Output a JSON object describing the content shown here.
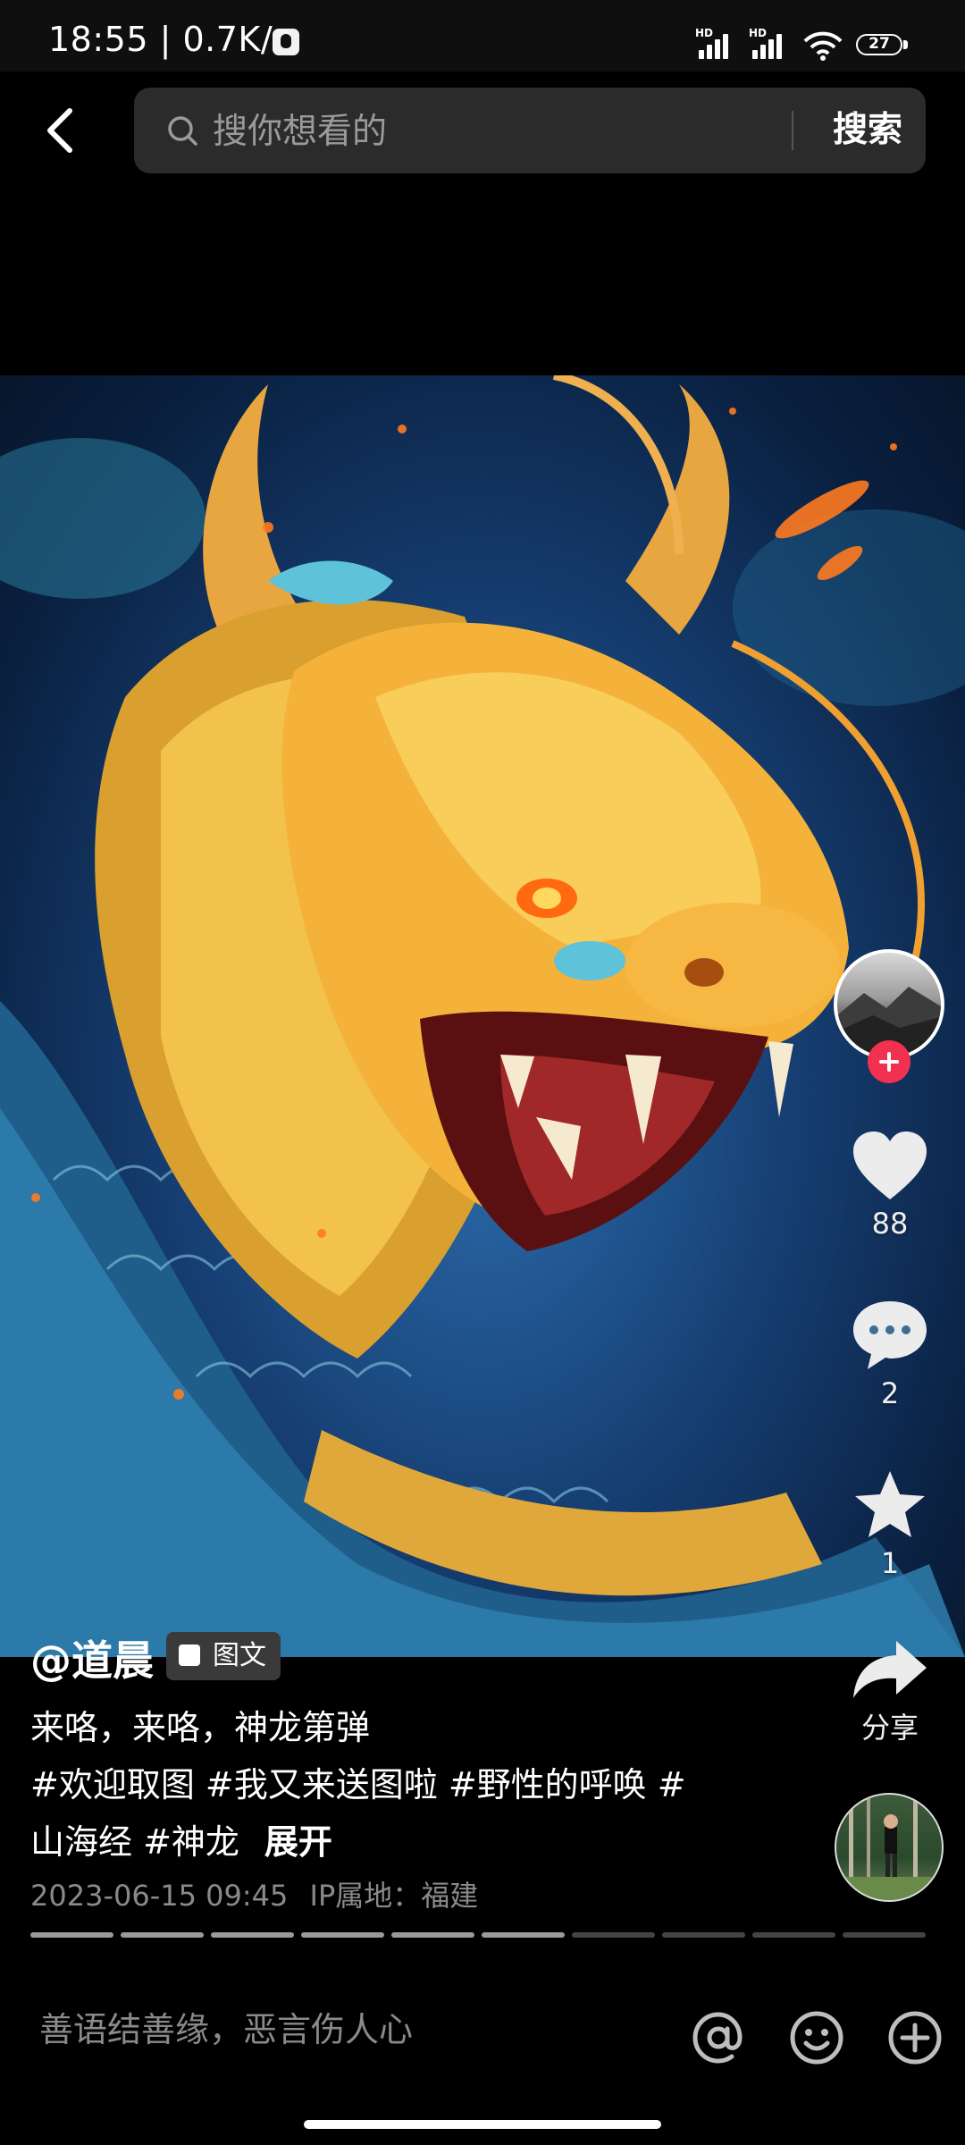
{
  "status_bar": {
    "time": "18:55",
    "network_speed": "0.7K/s",
    "battery_level": "27",
    "signal_label": "HD"
  },
  "search": {
    "placeholder": "搜你想看的",
    "button_label": "搜索"
  },
  "actions": {
    "like_count": "88",
    "comment_count": "2",
    "favorite_count": "1",
    "share_label": "分享"
  },
  "post": {
    "author": "@道晨",
    "type_label": "图文",
    "caption": "来咯，来咯，神龙第弹",
    "hashtags_line1": "#欢迎取图 #我又来送图啦 #野性的呼唤 #",
    "hashtags_line2": "山海经 #神龙",
    "expand_label": "展开",
    "datetime": "2023-06-15 09:45",
    "ip_location": "IP属地：福建"
  },
  "gallery": {
    "total_images": 10,
    "viewed_images": 6
  },
  "comment_bar": {
    "placeholder": "善语结善缘，恶言伤人心"
  },
  "colors": {
    "follow_accent": "#f2304f",
    "background": "#000000"
  }
}
